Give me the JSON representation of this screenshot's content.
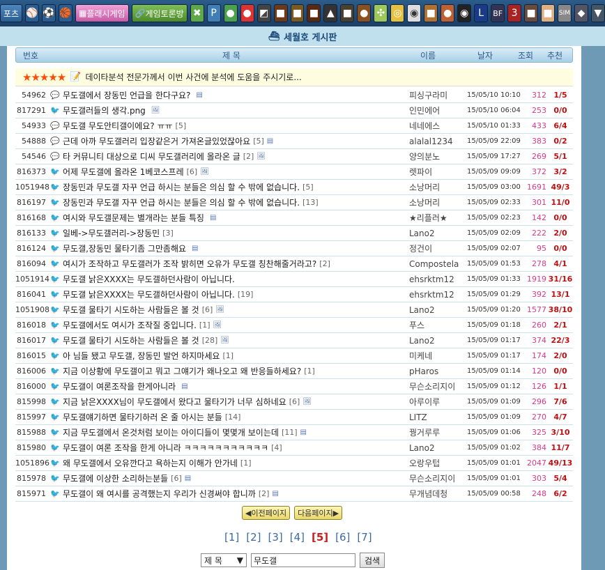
{
  "topbar": {
    "first_label": "포츠",
    "flash_label": "플래시게임",
    "debate_label": "게임토론방",
    "icons": [
      "baseball-icon",
      "soccer-icon",
      "basketball-icon",
      "flash-icon",
      "debate-icon",
      "xbox-icon",
      "playstation-icon",
      "mushroom-icon",
      "angry-bird-icon",
      "game-icon-1",
      "game-icon-2",
      "game-icon-3",
      "game-icon-4",
      "game-icon-5",
      "game-icon-6",
      "game-icon-7",
      "game-icon-8",
      "game-icon-9",
      "game-icon-10",
      "game-icon-11",
      "game-icon-12",
      "game-icon-13",
      "game-icon-14",
      "bf-icon",
      "game-icon-15",
      "game-icon-16",
      "game-icon-17",
      "sim-icon",
      "game-icon-18",
      "game-icon-19"
    ]
  },
  "board": {
    "title": "세월호 게시판"
  },
  "table_header": {
    "num": "번호",
    "title": "제 목",
    "name": "이름",
    "date": "날자",
    "views": "조회",
    "rec": "추천"
  },
  "notice": {
    "stars": "★★★★★",
    "text": "데이타분석 전문가께서 이번 사건에 분석에 도움을 주시기로..."
  },
  "rows": [
    {
      "num": "54962",
      "title": "무도갤에서 장동민 언급을 한다구요?",
      "cmt": "",
      "att": "doc",
      "name": "피싱구라미",
      "date": "15/05/10 10:10",
      "views": "312",
      "rec": "1/5",
      "icon": "balloon"
    },
    {
      "num": "817291",
      "title": "무도갤러들의 생각.png",
      "cmt": "",
      "att": "img",
      "name": "인민에어",
      "date": "15/05/10 06:04",
      "views": "253",
      "rec": "0/0",
      "icon": "bird"
    },
    {
      "num": "54933",
      "title": "무도갤 무도안티갤이에요? ㅠㅠ",
      "cmt": "[5]",
      "att": "",
      "name": "네네에스",
      "date": "15/05/10 01:33",
      "views": "433",
      "rec": "6/4",
      "icon": "balloon"
    },
    {
      "num": "54888",
      "title": "근데 아까 무도갤러리 입장같은거 가져온글있었잖아요",
      "cmt": "[5]",
      "att": "doc",
      "name": "alalal1234",
      "date": "15/05/09 22:09",
      "views": "383",
      "rec": "0/2",
      "icon": "balloon"
    },
    {
      "num": "54546",
      "title": "타 커뮤니티 대상으로 디씨 무도갤러리에 올라온 글",
      "cmt": "[2]",
      "att": "img",
      "name": "양의분노",
      "date": "15/05/09 17:27",
      "views": "269",
      "rec": "5/1",
      "icon": "balloon"
    },
    {
      "num": "816373",
      "title": "어제 무도갤에 올라온 1베코스프레",
      "cmt": "[6]",
      "att": "img",
      "name": "렛파이",
      "date": "15/05/09 09:09",
      "views": "372",
      "rec": "3/2",
      "icon": "bird"
    },
    {
      "num": "1051948",
      "title": "장동민과 무도갤 자꾸 언급 하시는 분들은 의심 할 수 밖에 없습니다.",
      "cmt": "[5]",
      "att": "",
      "name": "소낭머리",
      "date": "15/05/09 03:00",
      "views": "1691",
      "rec": "49/3",
      "icon": "bird"
    },
    {
      "num": "816197",
      "title": "장동민과 무도갤 자꾸 언급 하시는 분들은 의심 할 수 밖에 없습니다.",
      "cmt": "[13]",
      "att": "",
      "name": "소낭머리",
      "date": "15/05/09 02:33",
      "views": "301",
      "rec": "11/0",
      "icon": "bird"
    },
    {
      "num": "816168",
      "title": "여시와 무도갤문제는 별개라는 분들 특징",
      "cmt": "",
      "att": "doc",
      "name": "★리플러★",
      "date": "15/05/09 02:23",
      "views": "142",
      "rec": "0/0",
      "icon": "bird"
    },
    {
      "num": "816133",
      "title": "일베->무도갤러리->장동민",
      "cmt": "[3]",
      "att": "",
      "name": "Lano2",
      "date": "15/05/09 02:09",
      "views": "222",
      "rec": "2/0",
      "icon": "bird"
    },
    {
      "num": "816124",
      "title": "무도갤,장동민 물타기좀 그만좀해요",
      "cmt": "",
      "att": "doc",
      "name": "정건이",
      "date": "15/05/09 02:07",
      "views": "95",
      "rec": "0/0",
      "icon": "bird"
    },
    {
      "num": "816094",
      "title": "여시가 조작하고 무도갤러가 조작 밝히면 오유가 무도갤 칭찬해줄거라고?",
      "cmt": "[2]",
      "att": "",
      "name": "Compostela",
      "date": "15/05/09 01:53",
      "views": "278",
      "rec": "4/1",
      "icon": "bird"
    },
    {
      "num": "1051914",
      "title": "무도갤 낡은XXXX는 무도갤하던사람이 아닙니다.",
      "cmt": "",
      "att": "",
      "name": "ehsrktm12",
      "date": "15/05/09 01:33",
      "views": "1919",
      "rec": "31/16",
      "icon": "bird"
    },
    {
      "num": "816041",
      "title": "무도갤 낡은XXXX는 무도갤하던사람이 아닙니다.",
      "cmt": "[19]",
      "att": "",
      "name": "ehsrktm12",
      "date": "15/05/09 01:29",
      "views": "392",
      "rec": "13/1",
      "icon": "bird"
    },
    {
      "num": "1051908",
      "title": "무도갤 물타기 시도하는 사람들은 볼 것",
      "cmt": "[6]",
      "att": "img",
      "name": "Lano2",
      "date": "15/05/09 01:20",
      "views": "1577",
      "rec": "38/10",
      "icon": "bird"
    },
    {
      "num": "816018",
      "title": "무도갤에서도 여시가 조작질 중입니다.",
      "cmt": "[1]",
      "att": "img",
      "name": "푸스",
      "date": "15/05/09 01:18",
      "views": "260",
      "rec": "2/1",
      "icon": "bird"
    },
    {
      "num": "816017",
      "title": "무도갤 물타기 시도하는 사람들은 볼 것",
      "cmt": "[28]",
      "att": "img",
      "name": "Lano2",
      "date": "15/05/09 01:17",
      "views": "374",
      "rec": "22/3",
      "icon": "bird"
    },
    {
      "num": "816015",
      "title": "아 님들 됐고 무도갤, 장동민 발언 하지마세요",
      "cmt": "[1]",
      "att": "",
      "name": "미케네",
      "date": "15/05/09 01:17",
      "views": "174",
      "rec": "2/0",
      "icon": "bird"
    },
    {
      "num": "816006",
      "title": "지금 이상황에 무도갤이고 뭐고 그얘기가 왜나오고 왜 반응들하세요?",
      "cmt": "[1]",
      "att": "",
      "name": "pHaros",
      "date": "15/05/09 01:14",
      "views": "120",
      "rec": "0/0",
      "icon": "bird"
    },
    {
      "num": "816000",
      "title": "무도갤이 여론조작을 한게아니라",
      "cmt": "",
      "att": "doc",
      "name": "무슨소리지이",
      "date": "15/05/09 01:12",
      "views": "126",
      "rec": "1/1",
      "icon": "bird"
    },
    {
      "num": "815998",
      "title": "지금 낡은XXXX님이 무도갤에서 왔다고 물타기가 너무 심하네요",
      "cmt": "[6]",
      "att": "img",
      "name": "아루이루",
      "date": "15/05/09 01:09",
      "views": "296",
      "rec": "7/6",
      "icon": "bird"
    },
    {
      "num": "815997",
      "title": "무도갤얘기하면 물타기하러 온 줄 아시는 분들",
      "cmt": "[14]",
      "att": "",
      "name": "LITZ",
      "date": "15/05/09 01:09",
      "views": "270",
      "rec": "4/7",
      "icon": "bird"
    },
    {
      "num": "815988",
      "title": "지금 무도갤에서 온것처럼 보이는 아이디들이 몇몇개 보이는데",
      "cmt": "[11]",
      "att": "doc",
      "name": "꿩거루루",
      "date": "15/05/09 01:06",
      "views": "325",
      "rec": "3/10",
      "icon": "bird"
    },
    {
      "num": "815980",
      "title": "무도갤이 여론 조작을 한게 아니라 ㅋㅋㅋㅋㅋㅋㅋㅋㅋㅋㅋ",
      "cmt": "[4]",
      "att": "",
      "name": "Lano2",
      "date": "15/05/09 01:02",
      "views": "384",
      "rec": "11/7",
      "icon": "bird"
    },
    {
      "num": "1051896",
      "title": "왜 무도갤에서 오유깐다고 욕하는지 이해가 안가네",
      "cmt": "[1]",
      "att": "",
      "name": "오랑우텁",
      "date": "15/05/09 01:01",
      "views": "2047",
      "rec": "49/13",
      "icon": "bird"
    },
    {
      "num": "815978",
      "title": "무도갤에 이상한 소리하는분들",
      "cmt": "[6]",
      "att": "doc",
      "name": "무슨소리지이",
      "date": "15/05/09 01:01",
      "views": "303",
      "rec": "5/4",
      "icon": "bird"
    },
    {
      "num": "815971",
      "title": "무도갤이 왜 여시를 공격했는지 우리가 신경써야 합니까",
      "cmt": "[2]",
      "att": "doc",
      "name": "무개념데청",
      "date": "15/05/09 00:58",
      "views": "248",
      "rec": "6/2",
      "icon": "bird"
    }
  ],
  "pager": {
    "prev": "◀이전페이지",
    "next": "다음페이지▶",
    "pages": [
      "[1]",
      "[2]",
      "[3]",
      "[4]",
      "[5]",
      "[6]",
      "[7]"
    ],
    "current": "[5]"
  },
  "search": {
    "field": "제 목",
    "value": "무도갤",
    "button": "검색"
  }
}
